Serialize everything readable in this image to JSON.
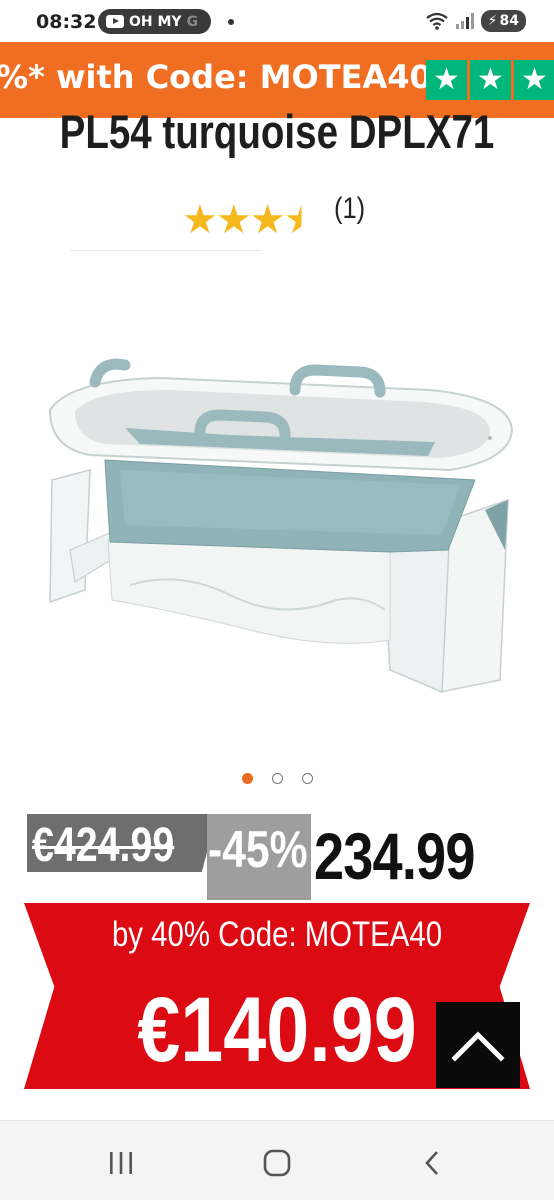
{
  "status_bar": {
    "time": "08:32",
    "pill_label": "OH MY",
    "pill_fade": "G",
    "battery": "84",
    "icons": [
      "youtube-icon",
      "wifi-icon",
      "signal-icon",
      "battery-icon"
    ]
  },
  "promo_banner": {
    "text": "%* with Code: MOTEA40 |",
    "trust_stars": [
      "★",
      "★",
      "★",
      "★"
    ],
    "accent_color": "#f06e22",
    "star_bg_color": "#00b67a"
  },
  "product": {
    "title": "PL54 turquoise DPLX71",
    "rating": {
      "stars": [
        "★",
        "★",
        "★",
        "★"
      ],
      "value_fraction": 0.75,
      "count": "(1)"
    },
    "image_icon": "foldable-bathtub-image",
    "carousel": {
      "total": 3,
      "active_index": 0
    }
  },
  "pricing": {
    "old_price": "€424.99",
    "discount": "-45%",
    "new_price": "234.99",
    "code_line": "by 40% Code: MOTEA40",
    "final_price": "€140.99",
    "red_color": "#dc0a12"
  },
  "scroll_top": {
    "icon": "chevron-up-icon"
  },
  "nav_bar": {
    "icons": [
      "recent-apps-icon",
      "home-icon",
      "back-icon"
    ]
  }
}
